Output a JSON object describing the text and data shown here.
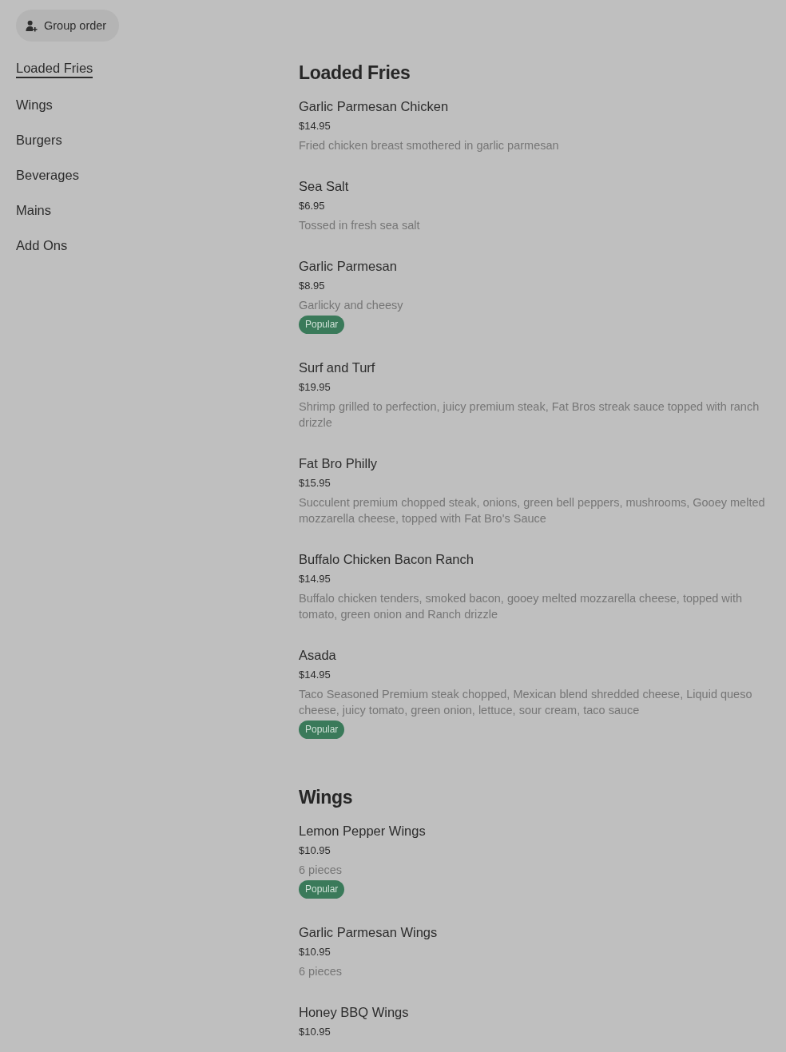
{
  "group_order_button": {
    "label": "Group order"
  },
  "sidebar": {
    "items": [
      {
        "label": "Loaded Fries",
        "selected": true
      },
      {
        "label": "Wings",
        "selected": false
      },
      {
        "label": "Burgers",
        "selected": false
      },
      {
        "label": "Beverages",
        "selected": false
      },
      {
        "label": "Mains",
        "selected": false
      },
      {
        "label": "Add Ons",
        "selected": false
      }
    ]
  },
  "sections": [
    {
      "title": "Loaded Fries",
      "items": [
        {
          "name": "Garlic Parmesan Chicken",
          "price": "$14.95",
          "description": "Fried chicken breast smothered in garlic parmesan"
        },
        {
          "name": "Sea Salt",
          "price": "$6.95",
          "description": "Tossed in fresh sea salt"
        },
        {
          "name": "Garlic Parmesan",
          "price": "$8.95",
          "description": "Garlicky and cheesy",
          "badge": "Popular"
        },
        {
          "name": "Surf and Turf",
          "price": "$19.95",
          "description": "Shrimp grilled to perfection, juicy premium steak, Fat Bros streak sauce topped with ranch drizzle"
        },
        {
          "name": "Fat Bro Philly",
          "price": "$15.95",
          "description": "Succulent premium chopped steak, onions, green bell peppers, mushrooms, Gooey melted mozzarella cheese, topped with Fat Bro's Sauce"
        },
        {
          "name": "Buffalo Chicken Bacon Ranch",
          "price": "$14.95",
          "description": "Buffalo chicken tenders, smoked bacon, gooey melted mozzarella cheese, topped with tomato, green onion and Ranch drizzle"
        },
        {
          "name": "Asada",
          "price": "$14.95",
          "description": "Taco Seasoned Premium steak chopped, Mexican blend shredded cheese, Liquid queso cheese, juicy tomato, green onion, lettuce, sour cream, taco sauce",
          "badge": "Popular"
        }
      ]
    },
    {
      "title": "Wings",
      "items": [
        {
          "name": "Lemon Pepper Wings",
          "price": "$10.95",
          "description": "6 pieces",
          "badge": "Popular"
        },
        {
          "name": "Garlic Parmesan Wings",
          "price": "$10.95",
          "description": "6 pieces"
        },
        {
          "name": "Honey BBQ Wings",
          "price": "$10.95"
        }
      ]
    }
  ]
}
